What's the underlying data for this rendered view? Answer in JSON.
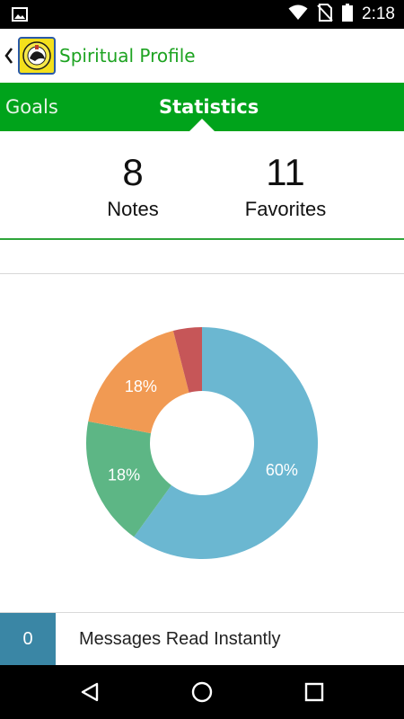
{
  "status_bar": {
    "time": "2:18"
  },
  "header": {
    "title": "Spiritual Profile"
  },
  "tabs": [
    {
      "label": "Goals"
    },
    {
      "label": "Statistics"
    }
  ],
  "counters": {
    "notes": {
      "value": "8",
      "label": "Notes"
    },
    "favorites": {
      "value": "11",
      "label": "Favorites"
    }
  },
  "chart_data": {
    "type": "pie",
    "style": "donut",
    "start_angle": "top",
    "direction": "clockwise",
    "slices": [
      {
        "value": 60,
        "label": "60%",
        "color": "#6bb7d1"
      },
      {
        "value": 18,
        "label": "18%",
        "color": "#5db685"
      },
      {
        "value": 18,
        "label": "18%",
        "color": "#f19a53"
      },
      {
        "value": 4,
        "label": "",
        "color": "#c65658"
      }
    ]
  },
  "stat_row": {
    "count": "0",
    "label": "Messages Read Instantly"
  },
  "colors": {
    "accent_green": "#00a31b",
    "title_green": "#1da321",
    "stat_blue": "#3a86a5"
  },
  "icons": {
    "status_left": "image-icon",
    "status_right": [
      "wifi-icon",
      "no-sim-icon",
      "battery-icon"
    ],
    "nav": [
      "back-triangle-icon",
      "home-circle-icon",
      "recents-square-icon"
    ]
  }
}
